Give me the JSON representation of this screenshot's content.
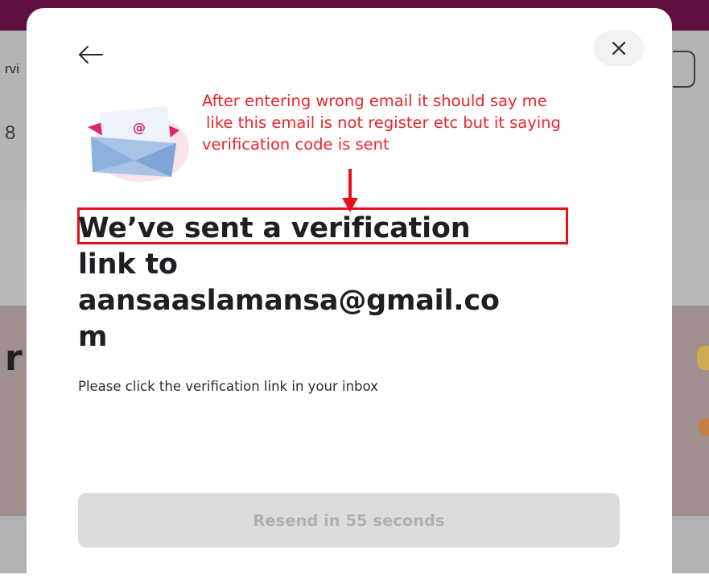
{
  "background": {
    "left_text": "rvi",
    "left_glyph": "8",
    "left_big": "r"
  },
  "modal": {
    "back_icon": "arrow-left-icon",
    "close_icon": "close-icon",
    "illustration_icon": "envelope-icon",
    "illustration_symbol": "@",
    "headline": {
      "line1": "We’ve sent a verification",
      "line2": "link to",
      "line3": "aansaaslamansa@gmail.co",
      "line4": "m"
    },
    "subtext": "Please click the verification link in your inbox",
    "resend_label": "Resend in 55 seconds"
  },
  "annotation": {
    "line1": "After entering wrong email it should say me",
    "line2": "like this email is not register etc but it saying",
    "line3": "verification code is sent"
  },
  "colors": {
    "annotation": "#e8262c",
    "headline": "#1e1e23",
    "top_bar": "#5e0f3d",
    "resend_bg": "#dcdcdd"
  }
}
